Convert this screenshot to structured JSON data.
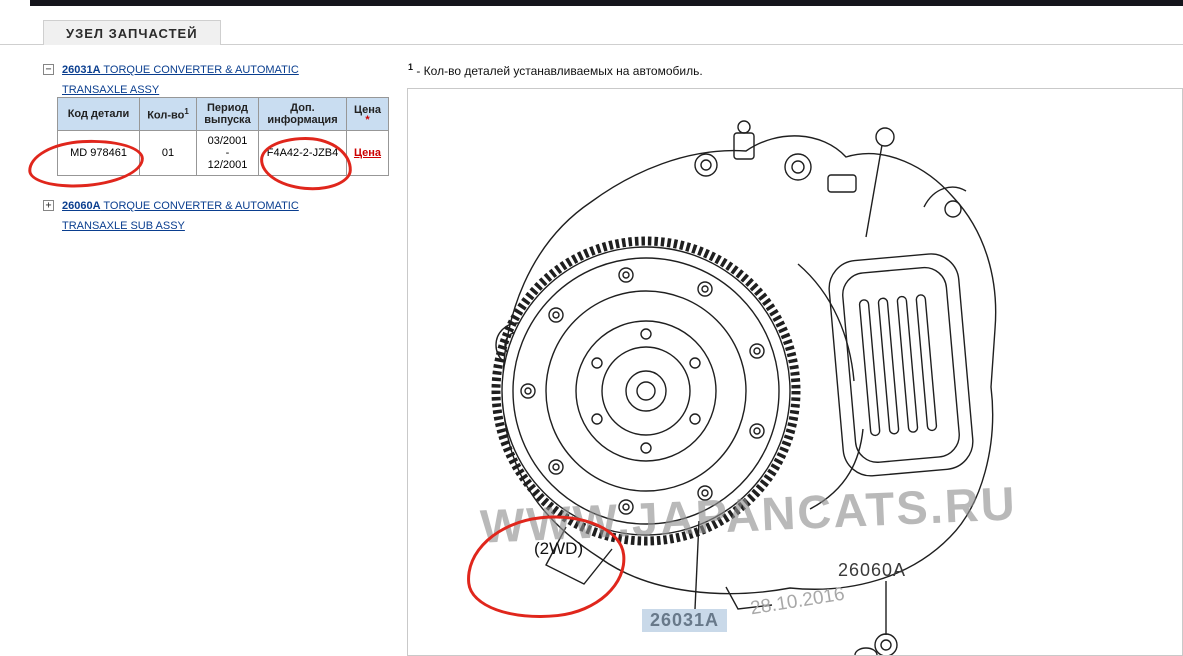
{
  "colors": {
    "header_bg": "#c9ddf1",
    "link": "#0a3e8f",
    "price_link": "#cc0000",
    "annotation": "#e0261c",
    "highlight": "#c9d9e9"
  },
  "tab": {
    "title": "УЗЕЛ ЗАПЧАСТЕЙ"
  },
  "icons": {
    "collapse": "−",
    "expand": "+"
  },
  "tree": {
    "nodes": [
      {
        "code": "26031A",
        "name": " TORQUE CONVERTER & AUTOMATIC TRANSAXLE ASSY",
        "expanded": true
      },
      {
        "code": "26060A",
        "name": " TORQUE CONVERTER & AUTOMATIC TRANSAXLE SUB ASSY",
        "expanded": false
      }
    ]
  },
  "table": {
    "headers": {
      "part_code": "Код детали",
      "qty": "Кол-во",
      "qty_sup": "1",
      "period": "Период\nвыпуска",
      "info": "Доп.\nинформация",
      "price": "Цена",
      "price_sup": "*"
    },
    "row": {
      "part_code": "MD 978461",
      "qty": "01",
      "period": "03/2001\n-\n12/2001",
      "info": "F4A42-2-JZB4",
      "price": "Цена"
    }
  },
  "note": {
    "sup": "1",
    "text": " - Кол-во деталей устанавливаемых на автомобиль."
  },
  "diagram": {
    "drive_label": "(2WD)",
    "label_26031": "26031A",
    "label_26060": "26060A",
    "date": "28.10.2016",
    "watermark": "WWW.JAPANCATS.RU"
  }
}
